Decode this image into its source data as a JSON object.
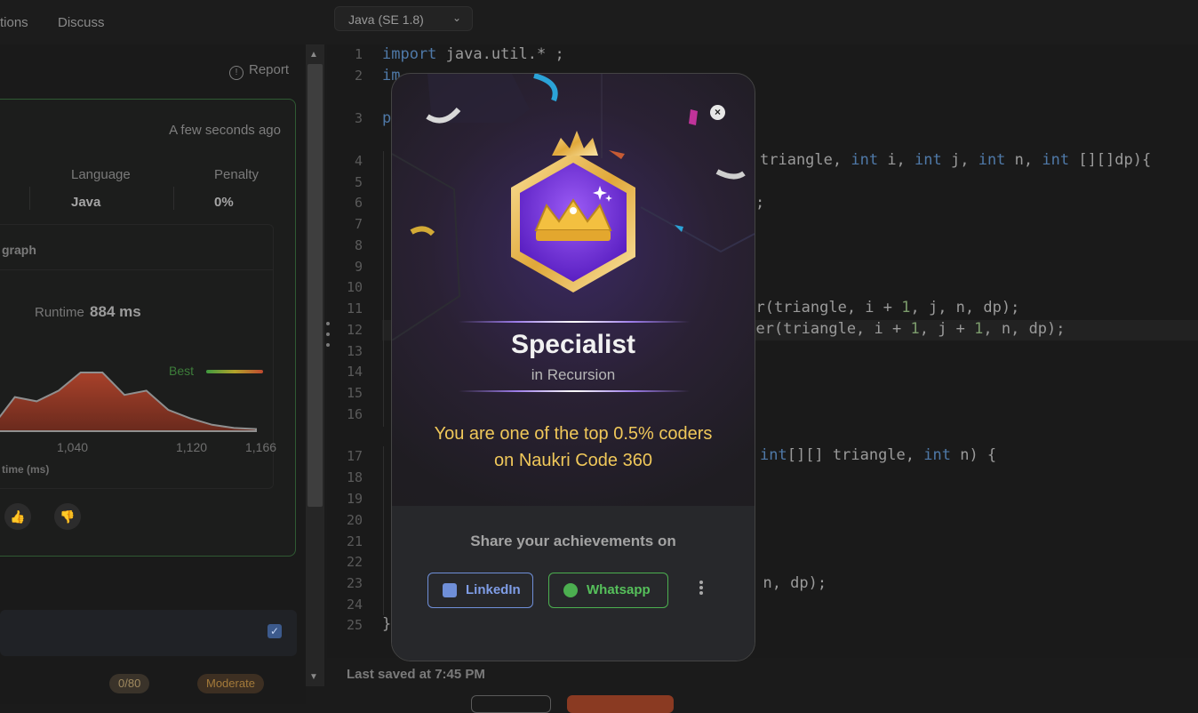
{
  "top_bar": {
    "tabs": [
      "tions",
      "Discuss"
    ],
    "language_select": {
      "value": "Java (SE 1.8)"
    }
  },
  "left_panel": {
    "report_label": "Report",
    "submission": {
      "time_ago": "A few seconds ago",
      "stats": [
        {
          "label": "Language",
          "value": "Java"
        },
        {
          "label": "Penalty",
          "value": "0%"
        }
      ],
      "graph_title": "graph",
      "runtime_label": "Runtime",
      "runtime_value": "884 ms",
      "best_label": "Best",
      "x_ticks": [
        "1,040",
        "1,120",
        "1,166"
      ],
      "x_label": "time (ms)"
    },
    "score_pill": "0/80",
    "difficulty_pill": "Moderate"
  },
  "editor": {
    "line_numbers": [
      "1",
      "2",
      "",
      "3",
      "",
      "4",
      "5",
      "6",
      "7",
      "8",
      "9",
      "10",
      "11",
      "12",
      "13",
      "14",
      "15",
      "16",
      "",
      "17",
      "18",
      "19",
      "20",
      "21",
      "22",
      "23",
      "24",
      "25"
    ],
    "lines": [
      {
        "n": "1",
        "parts": [
          {
            "t": "import",
            "k": "kw"
          },
          {
            "t": " java.util.* ;",
            "k": ""
          }
        ]
      },
      {
        "n": "2",
        "parts": [
          {
            "t": "im",
            "k": "kw"
          }
        ]
      },
      {
        "n": "3",
        "parts": [
          {
            "t": "p",
            "k": "kw"
          }
        ]
      },
      {
        "n": "4",
        "parts": [
          {
            "t": "triangle, ",
            "k": ""
          },
          {
            "t": "int",
            "k": "kw"
          },
          {
            "t": " i, ",
            "k": ""
          },
          {
            "t": "int",
            "k": "kw"
          },
          {
            "t": " j, ",
            "k": ""
          },
          {
            "t": "int",
            "k": "kw"
          },
          {
            "t": " n, ",
            "k": ""
          },
          {
            "t": "int",
            "k": "kw"
          },
          {
            "t": " [][]dp){",
            "k": ""
          }
        ]
      },
      {
        "n": "6",
        "parts": [
          {
            "t": ";",
            "k": ""
          }
        ]
      },
      {
        "n": "11",
        "parts": [
          {
            "t": "ver(triangle, i + ",
            "k": ""
          },
          {
            "t": "1",
            "k": "num"
          },
          {
            "t": ", j, n, dp);",
            "k": ""
          }
        ]
      },
      {
        "n": "12",
        "parts": [
          {
            "t": "lver(triangle, i + ",
            "k": ""
          },
          {
            "t": "1",
            "k": "num"
          },
          {
            "t": ", j + ",
            "k": ""
          },
          {
            "t": "1",
            "k": "num"
          },
          {
            "t": ", n, dp);",
            "k": ""
          }
        ]
      },
      {
        "n": "17",
        "parts": [
          {
            "t": "int",
            "k": "kw"
          },
          {
            "t": "[][] triangle, ",
            "k": ""
          },
          {
            "t": "int",
            "k": "kw"
          },
          {
            "t": " n) {",
            "k": ""
          }
        ]
      },
      {
        "n": "23",
        "parts": [
          {
            "t": ", n, dp);",
            "k": ""
          }
        ]
      },
      {
        "n": "25",
        "parts": [
          {
            "t": "}",
            "k": ""
          }
        ]
      }
    ],
    "last_saved": "Last saved at 7:45 PM"
  },
  "modal": {
    "title": "Specialist",
    "subtitle": "in Recursion",
    "message_line1": "You are one of the top 0.5% coders",
    "message_line2": "on Naukri Code 360",
    "share_prompt": "Share your achievements on",
    "linkedin_label": "LinkedIn",
    "whatsapp_label": "Whatsapp",
    "colors": {
      "accent_gold": "#f0c85a",
      "badge_purple": "#7a3ce0",
      "linkedin": "#6f8fd8",
      "whatsapp": "#4caf50"
    }
  },
  "chart_data": {
    "type": "area",
    "title": "",
    "xlabel": "time (ms)",
    "ylabel": "",
    "x_ticks": [
      1040,
      1120,
      1166
    ],
    "series": [
      {
        "values": [
          0.05,
          0.32,
          0.28,
          0.38,
          0.55,
          0.55,
          0.34,
          0.38,
          0.2,
          0.12,
          0.06,
          0.03,
          0.02
        ]
      }
    ],
    "legend": "Best"
  }
}
